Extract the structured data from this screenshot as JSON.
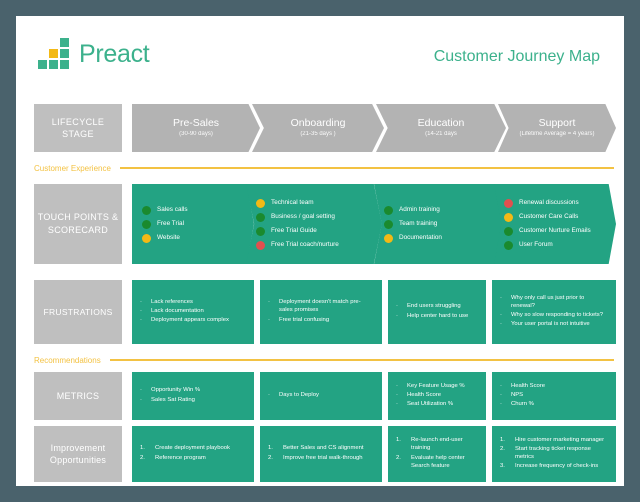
{
  "brand": {
    "name": "Preact",
    "logo_icon": "preact-squares-logo",
    "colors": {
      "teal": "#3cb18c",
      "yellow": "#f3b915"
    }
  },
  "header": {
    "title": "Customer Journey Map"
  },
  "colors": {
    "teal": "#23a383",
    "grey": "#bfbfbf",
    "chevron_grey": "#b3b3b3",
    "yellow": "#f3c243",
    "dot_green": "#1a8a2e",
    "dot_yellow": "#f3b915",
    "dot_red": "#e0504f",
    "page_background": "#4a626c"
  },
  "bands": {
    "customer_experience": "Customer Experience",
    "recommendations": "Recommendations"
  },
  "rows": {
    "lifecycle_label": "LIFECYCLE STAGE",
    "touchpoints_label": "TOUCH POINTS & SCORECARD",
    "frustrations_label": "FRUSTRATIONS",
    "metrics_label": "METRICS",
    "improvements_label": "Improvement Opportunities"
  },
  "stages": [
    {
      "name": "Pre-Sales",
      "duration": "(30-90 days)"
    },
    {
      "name": "Onboarding",
      "duration": "(21-35 days )"
    },
    {
      "name": "Education",
      "duration": "(14-21 days"
    },
    {
      "name": "Support",
      "duration": "(Lifetime Average = 4 years)"
    }
  ],
  "touchpoints": [
    {
      "stage": "Pre-Sales",
      "items": [
        {
          "label": "Sales calls",
          "status": "green"
        },
        {
          "label": "Free Trial",
          "status": "green"
        },
        {
          "label": "Website",
          "status": "yellow"
        }
      ]
    },
    {
      "stage": "Onboarding",
      "items": [
        {
          "label": "Technical team",
          "status": "yellow"
        },
        {
          "label": "Business / goal setting",
          "status": "green"
        },
        {
          "label": "Free Trial Guide",
          "status": "green"
        },
        {
          "label": "Free Trial coach/nurture",
          "status": "red"
        }
      ]
    },
    {
      "stage": "Education",
      "items": [
        {
          "label": "Admin training",
          "status": "green"
        },
        {
          "label": "Team training",
          "status": "green"
        },
        {
          "label": "Documentation",
          "status": "yellow"
        }
      ]
    },
    {
      "stage": "Support",
      "items": [
        {
          "label": "Renewal discussions",
          "status": "red"
        },
        {
          "label": "Customer Care Calls",
          "status": "yellow"
        },
        {
          "label": "Customer Nurture Emails",
          "status": "green"
        },
        {
          "label": "User Forum",
          "status": "green"
        }
      ]
    }
  ],
  "frustrations": [
    {
      "stage": "Pre-Sales",
      "items": [
        "Lack references",
        "Lack documentation",
        "Deployment appears complex"
      ]
    },
    {
      "stage": "Onboarding",
      "items": [
        "Deployment doesn't match pre-sales promises",
        "Free trial confusing"
      ]
    },
    {
      "stage": "Education",
      "items": [
        "End users struggling",
        "Help center hard to use"
      ]
    },
    {
      "stage": "Support",
      "items": [
        "Why only call us just prior to renewal?",
        "Why so slow responding to tickets?",
        "Your user portal is not intuitive"
      ]
    }
  ],
  "metrics": [
    {
      "stage": "Pre-Sales",
      "items": [
        "Opportunity Win %",
        "Sales Sat Rating"
      ]
    },
    {
      "stage": "Onboarding",
      "items": [
        "Days to Deploy"
      ]
    },
    {
      "stage": "Education",
      "items": [
        "Key Feature Usage %",
        "Health Score",
        "Seat Utilization %"
      ]
    },
    {
      "stage": "Support",
      "items": [
        "Health Score",
        "NPS",
        "Churn %"
      ]
    }
  ],
  "improvements": [
    {
      "stage": "Pre-Sales",
      "items": [
        "Create deployment playbook",
        "Reference program"
      ]
    },
    {
      "stage": "Onboarding",
      "items": [
        "Better Sales and CS alignment",
        "Improve free trial walk-through"
      ]
    },
    {
      "stage": "Education",
      "items": [
        "Re-launch end-user training",
        "Evaluate help center Search feature"
      ]
    },
    {
      "stage": "Support",
      "items": [
        "Hire customer marketing manager",
        "Start tracking ticket response metrics",
        "Increase frequency of check-ins"
      ]
    }
  ]
}
